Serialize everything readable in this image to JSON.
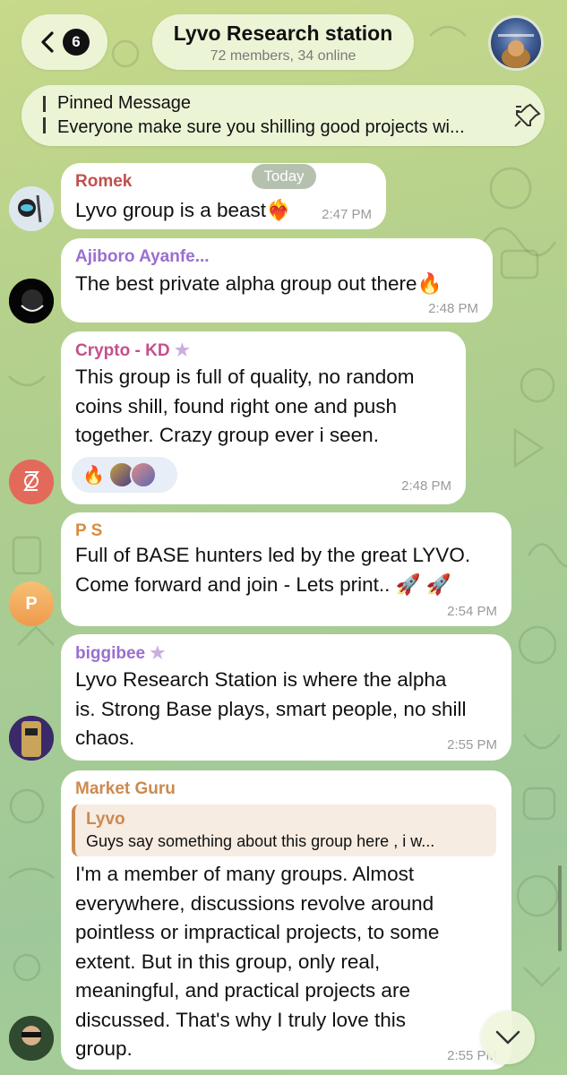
{
  "header": {
    "back_count": "6",
    "title": "Lyvo Research station",
    "subtitle": "72 members, 34 online"
  },
  "pinned": {
    "title": "Pinned Message",
    "text": "Everyone make sure you shilling good projects wi..."
  },
  "date_chip": "Today",
  "messages": [
    {
      "sender": "Romek",
      "sender_color": "#c0504d",
      "text": "Lyvo group is a beast❤️‍🔥",
      "time": "2:47 PM"
    },
    {
      "sender": "Ajiboro Ayanfe...",
      "sender_color": "#9a6fcf",
      "text": "The best private alpha group out there🔥",
      "time": "2:48 PM"
    },
    {
      "sender": "Crypto - KD",
      "sender_color": "#c5508a",
      "lines": [
        "This group is full of quality, no random",
        "coins shill, found right one and push",
        "together. Crazy group ever i seen."
      ],
      "time": "2:48 PM",
      "reaction": "🔥"
    },
    {
      "sender": "P S",
      "sender_color": "#d98c3f",
      "lines": [
        "Full of BASE hunters led by the great LYVO.",
        "Come forward and join - Lets print.. 🚀 🚀"
      ],
      "time": "2:54 PM",
      "avatar_letter": "P"
    },
    {
      "sender": "biggibee",
      "sender_color": "#9a6fcf",
      "lines": [
        "Lyvo Research Station is where the alpha",
        "is. Strong Base plays, smart people, no shill",
        "chaos."
      ],
      "time": "2:55 PM"
    },
    {
      "sender": "Market Guru",
      "sender_color": "#cc8a4f",
      "reply_name": "Lyvo",
      "reply_text": "Guys say something about this group here , i w...",
      "lines": [
        "I'm a member of many groups. Almost",
        "everywhere, discussions revolve around",
        "pointless or impractical projects, to some",
        "extent. But in this group, only real,",
        "meaningful, and practical projects are",
        "discussed. That's why I truly love this",
        "group."
      ],
      "time": "2:55 PM"
    }
  ],
  "star_glyph": "★",
  "icons": [
    "chevron-left-icon",
    "unpin-icon",
    "chevron-down-icon"
  ]
}
